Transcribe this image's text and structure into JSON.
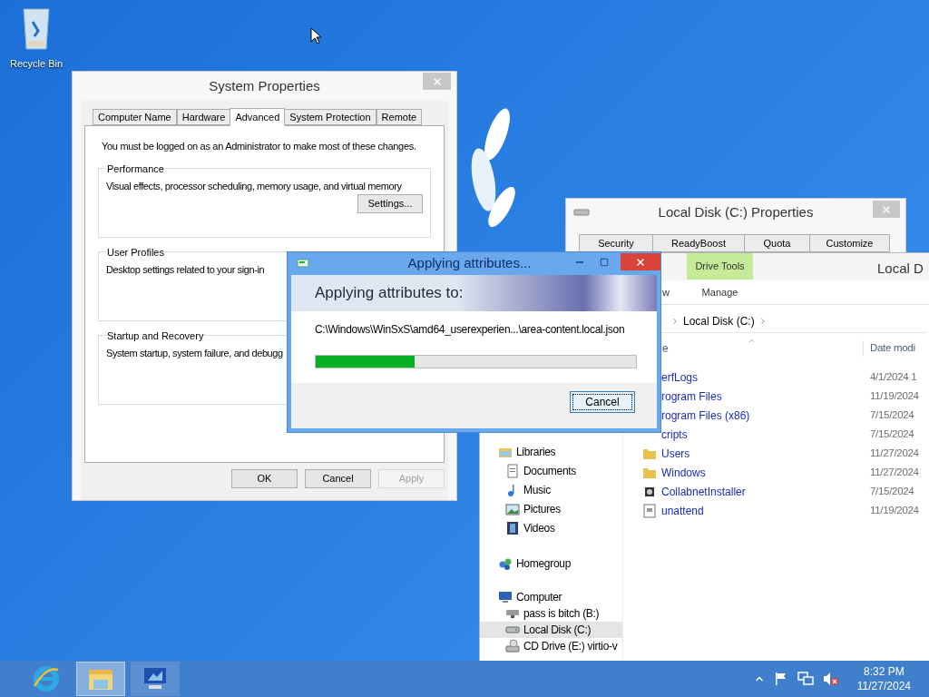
{
  "desktop": {
    "icons": [
      {
        "label": "Recycle Bin"
      }
    ]
  },
  "system_properties": {
    "title": "System Properties",
    "tabs": [
      {
        "label": "Computer Name",
        "selected": false
      },
      {
        "label": "Hardware",
        "selected": false
      },
      {
        "label": "Advanced",
        "selected": true
      },
      {
        "label": "System Protection",
        "selected": false
      },
      {
        "label": "Remote",
        "selected": false
      }
    ],
    "notice": "You must be logged on as an Administrator to make most of these changes.",
    "groups": [
      {
        "title": "Performance",
        "text": "Visual effects, processor scheduling, memory usage, and virtual memory",
        "button": "Settings..."
      },
      {
        "title": "User Profiles",
        "text": "Desktop settings related to your sign-in"
      },
      {
        "title": "Startup and Recovery",
        "text": "System startup, system failure, and debugg"
      }
    ],
    "buttons": [
      {
        "label": "OK",
        "disabled": false
      },
      {
        "label": "Cancel",
        "disabled": false
      },
      {
        "label": "Apply",
        "disabled": true
      }
    ]
  },
  "disk_properties": {
    "title": "Local Disk (C:) Properties",
    "tabs": [
      {
        "label": "Security",
        "selected": false
      },
      {
        "label": "ReadyBoost",
        "selected": false
      },
      {
        "label": "Quota",
        "selected": false
      },
      {
        "label": "Customize",
        "selected": false
      }
    ]
  },
  "explorer": {
    "title": "Local D",
    "context_tab": "Drive Tools",
    "ribbon_tabs": [
      "w",
      "Manage"
    ],
    "breadcrumb": [
      "Local Disk (C:)"
    ],
    "columns": [
      "e",
      "Date modi"
    ],
    "nav": [
      {
        "label": "Libraries",
        "kind": "library",
        "selected": false,
        "children": [
          {
            "label": "Documents",
            "kind": "document",
            "selected": false
          },
          {
            "label": "Music",
            "kind": "music",
            "selected": false
          },
          {
            "label": "Pictures",
            "kind": "pictures",
            "selected": false
          },
          {
            "label": "Videos",
            "kind": "videos",
            "selected": false
          }
        ]
      },
      {
        "label": "Homegroup",
        "kind": "homegroup",
        "selected": false
      },
      {
        "label": "Computer",
        "kind": "computer",
        "selected": false,
        "children": [
          {
            "label": "pass is bitch (B:)",
            "kind": "netdrive",
            "selected": false
          },
          {
            "label": "Local Disk (C:)",
            "kind": "disk",
            "selected": true
          },
          {
            "label": "CD Drive (E:) virtio-v",
            "kind": "cd",
            "selected": false
          }
        ]
      }
    ],
    "files": [
      {
        "name": "erfLogs",
        "date": "4/1/2024 1"
      },
      {
        "name": "rogram Files",
        "date": "11/19/2024"
      },
      {
        "name": "rogram Files (x86)",
        "date": "7/15/2024"
      },
      {
        "name": "cripts",
        "date": "7/15/2024"
      },
      {
        "name": "Users",
        "date": "11/27/2024",
        "kind": "folder"
      },
      {
        "name": "Windows",
        "date": "11/27/2024",
        "kind": "folder"
      },
      {
        "name": "CollabnetInstaller",
        "date": "7/15/2024",
        "kind": "app"
      },
      {
        "name": "unattend",
        "date": "11/19/2024",
        "kind": "file"
      }
    ]
  },
  "progress_dialog": {
    "title": "Applying attributes...",
    "heading": "Applying attributes to:",
    "path": "C:\\Windows\\WinSxS\\amd64_userexperien...\\area-content.local.json",
    "level": 0.31,
    "button": "Cancel"
  },
  "taskbar": {
    "apps": [
      {
        "kind": "browser",
        "selected": false
      },
      {
        "kind": "explorer",
        "selected": true
      },
      {
        "kind": "system",
        "selected": false
      }
    ],
    "time": "8:32 PM",
    "date": "11/27/2024"
  }
}
